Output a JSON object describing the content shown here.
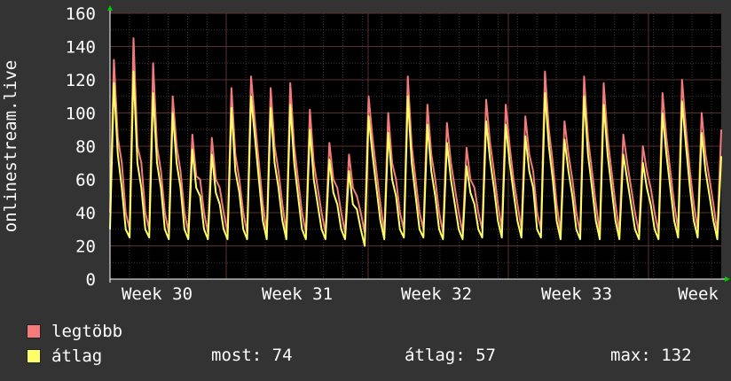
{
  "chart_data": {
    "type": "line",
    "ylabel": "onlinestream.live",
    "ylim": [
      0,
      160
    ],
    "y_ticks": [
      "0",
      "20",
      "40",
      "60",
      "80",
      "100",
      "120",
      "140",
      "160"
    ],
    "x_labels": [
      "Week 30",
      "Week 31",
      "Week 32",
      "Week 33",
      "Week"
    ],
    "grid": true,
    "background": "#000000",
    "legend_position": "bottom-left",
    "series": [
      {
        "name": "legtöbb",
        "color": "#f57b7b",
        "values": [
          40,
          132,
          85,
          70,
          40,
          30,
          145,
          80,
          70,
          40,
          30,
          130,
          80,
          65,
          40,
          28,
          110,
          80,
          65,
          40,
          28,
          87,
          62,
          60,
          40,
          28,
          85,
          60,
          55,
          40,
          28,
          115,
          75,
          60,
          40,
          28,
          122,
          95,
          70,
          45,
          28,
          115,
          80,
          65,
          45,
          28,
          118,
          80,
          60,
          40,
          28,
          102,
          70,
          55,
          40,
          28,
          82,
          60,
          55,
          40,
          28,
          75,
          55,
          50,
          40,
          28,
          110,
          85,
          65,
          45,
          28,
          100,
          70,
          60,
          40,
          30,
          122,
          80,
          60,
          40,
          30,
          105,
          75,
          60,
          40,
          28,
          94,
          70,
          55,
          40,
          28,
          79,
          60,
          55,
          40,
          30,
          108,
          82,
          65,
          45,
          30,
          105,
          80,
          60,
          45,
          30,
          98,
          75,
          65,
          40,
          30,
          125,
          90,
          70,
          45,
          28,
          95,
          75,
          60,
          40,
          28,
          122,
          85,
          65,
          45,
          28,
          118,
          85,
          65,
          45,
          28,
          87,
          70,
          55,
          40,
          28,
          80,
          65,
          55,
          40,
          28,
          112,
          85,
          65,
          45,
          30,
          120,
          90,
          65,
          45,
          30,
          100,
          75,
          60,
          45,
          28,
          90
        ]
      },
      {
        "name": "átlag",
        "color": "#ffff66",
        "values": [
          30,
          118,
          75,
          55,
          30,
          25,
          125,
          70,
          55,
          30,
          25,
          112,
          70,
          55,
          30,
          24,
          100,
          70,
          55,
          30,
          24,
          78,
          55,
          50,
          30,
          24,
          75,
          52,
          45,
          30,
          24,
          103,
          65,
          52,
          30,
          24,
          110,
          85,
          60,
          35,
          24,
          103,
          70,
          55,
          35,
          24,
          105,
          70,
          50,
          30,
          24,
          90,
          60,
          45,
          30,
          24,
          72,
          52,
          45,
          30,
          24,
          65,
          45,
          42,
          30,
          20,
          98,
          75,
          55,
          35,
          24,
          88,
          60,
          50,
          30,
          25,
          110,
          70,
          50,
          30,
          25,
          93,
          65,
          50,
          30,
          24,
          82,
          60,
          45,
          30,
          24,
          68,
          52,
          45,
          30,
          25,
          95,
          72,
          55,
          35,
          25,
          93,
          70,
          52,
          35,
          25,
          86,
          65,
          55,
          30,
          25,
          112,
          80,
          60,
          35,
          24,
          84,
          65,
          50,
          30,
          24,
          110,
          75,
          55,
          35,
          24,
          105,
          75,
          55,
          35,
          24,
          75,
          60,
          45,
          30,
          24,
          70,
          55,
          45,
          30,
          24,
          100,
          75,
          55,
          35,
          25,
          107,
          80,
          55,
          35,
          25,
          88,
          65,
          50,
          35,
          24,
          74
        ]
      }
    ]
  },
  "legend": {
    "max_label": "legtöbb",
    "avg_label": "átlag",
    "most_text": "most: 74",
    "atlag_text": "átlag: 57",
    "max_text": "max: 132"
  }
}
